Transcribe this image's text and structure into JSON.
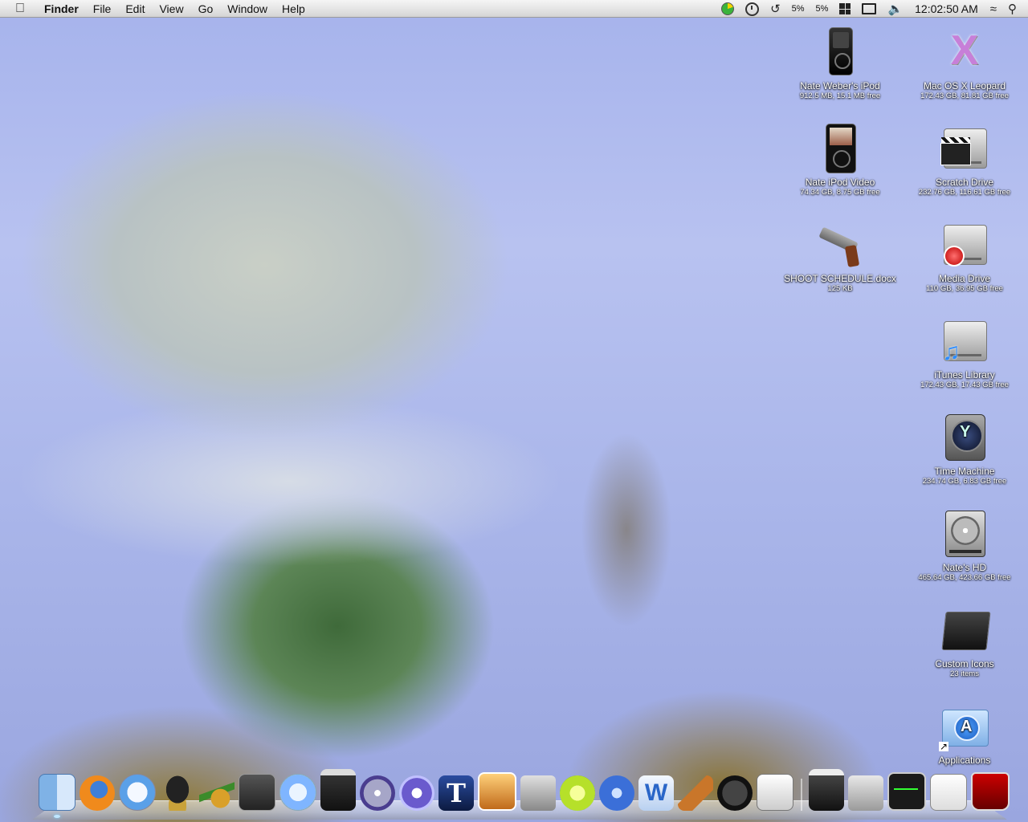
{
  "menubar": {
    "app": "Finder",
    "menus": [
      "File",
      "Edit",
      "View",
      "Go",
      "Window",
      "Help"
    ],
    "status": {
      "cpu1": "5%",
      "cpu2": "5%",
      "clock": "12:02:50 AM"
    }
  },
  "desktop": {
    "icons": [
      {
        "name": "Nate Weber's iPod",
        "sub": "912.5 MB, 15.1 MB free"
      },
      {
        "name": "Mac OS X Leopard",
        "sub": "172.43 GB, 81.81 GB free"
      },
      {
        "name": "Nate iPod Video",
        "sub": "74.34 GB, 8.75 GB free"
      },
      {
        "name": "Scratch Drive",
        "sub": "232.76 GB, 116.61 GB free"
      },
      {
        "name": "SHOOT SCHEDULE.docx",
        "sub": "125 KB"
      },
      {
        "name": "Media Drive",
        "sub": "110 GB, 36.95 GB free"
      },
      {
        "name": "iTunes Library",
        "sub": "172.43 GB, 17.43 GB free"
      },
      {
        "name": "Time Machine",
        "sub": "234.74 GB, 6.83 GB free"
      },
      {
        "name": "Nate's HD",
        "sub": "465.64 GB, 423.66 GB free"
      },
      {
        "name": "Custom Icons",
        "sub": "23 items"
      },
      {
        "name": "Applications",
        "sub": ""
      }
    ]
  },
  "dock": {
    "items": [
      "finder-icon",
      "firefox-icon",
      "safari-icon",
      "ninja-icon",
      "pina-colada-icon",
      "film-icon",
      "itunes-icon",
      "final-cut-icon",
      "dvd-studio-icon",
      "motion-icon",
      "livetype-icon",
      "iphoto-icon",
      "utility-icon",
      "limewire-icon",
      "globe-icon",
      "word-icon",
      "garageband-icon",
      "dashboard-icon",
      "app-icon",
      "final-cut-2-icon",
      "system-prefs-icon",
      "activity-monitor-icon",
      "document-stack-icon",
      "trash-icon"
    ]
  }
}
